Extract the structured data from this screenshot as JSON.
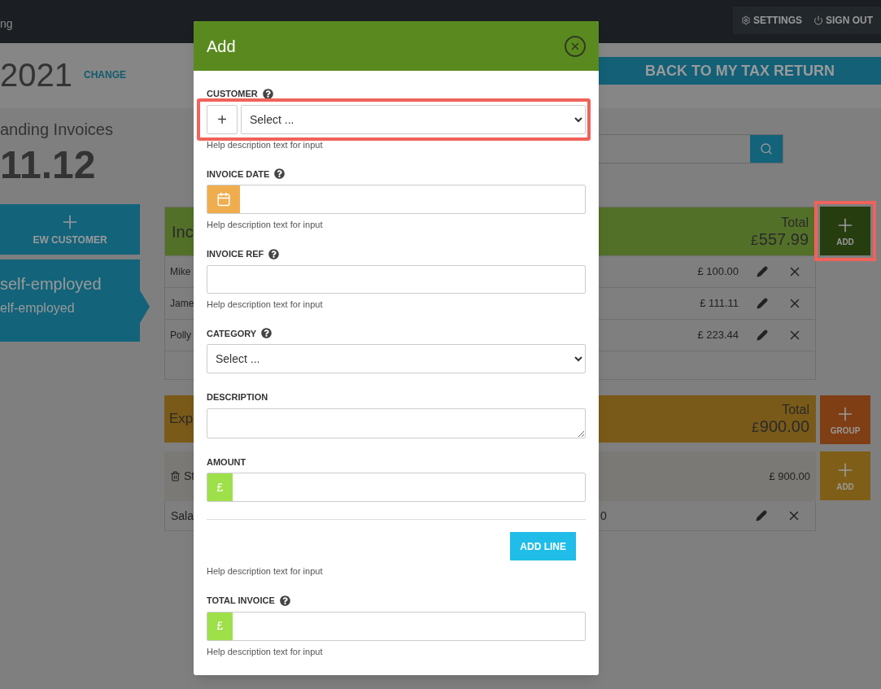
{
  "top_bar": {
    "brand_fragment": "ng",
    "menu": [
      {
        "label": "SETTINGS"
      },
      {
        "label": "SIGN OUT"
      }
    ]
  },
  "period": {
    "year": "2021",
    "change_link": "CHANGE"
  },
  "back_button": "BACK TO MY TAX RETURN",
  "summary": {
    "label": "anding Invoices",
    "amount": "11.12"
  },
  "sidebar": {
    "new_customer": "EW CUSTOMER",
    "items": [
      {
        "title": "self-employed",
        "subtitle": "elf-employed"
      }
    ]
  },
  "income": {
    "title": "Inc",
    "total_label": "Total",
    "currency": "£",
    "total": "557.99",
    "add_label": "ADD",
    "add_highlighted": true,
    "rows": [
      {
        "name": "Mike",
        "amount": "£ 100.00"
      },
      {
        "name": "Jame",
        "amount": "£ 111.11"
      },
      {
        "name": "Polly",
        "amount": "£ 223.44"
      }
    ]
  },
  "expenses": {
    "title": "Exp",
    "total_label": "Total",
    "currency": "£",
    "total": "900.00",
    "group_label": "GROUP",
    "groups": [
      {
        "name": "St",
        "amount": "£ 900.00",
        "add_label": "ADD",
        "rows": [
          {
            "name": "Sala",
            "amount": "0"
          }
        ]
      }
    ]
  },
  "modal": {
    "title": "Add",
    "items": [
      {
        "kind": "select",
        "label": "CUSTOMER",
        "help_icon": true,
        "addon": "+",
        "placeholder": "Select ...",
        "help": "Help description text for input",
        "highlighted": true
      },
      {
        "kind": "date",
        "label": "INVOICE DATE",
        "help_icon": true,
        "help": "Help description text for input",
        "highlighted": false
      },
      {
        "kind": "text",
        "label": "INVOICE REF",
        "help_icon": true,
        "help": "Help description text for input",
        "highlighted": false
      },
      {
        "kind": "select",
        "label": "CATEGORY",
        "help_icon": true,
        "placeholder": "Select ...",
        "highlighted": false
      },
      {
        "kind": "textarea",
        "label": "DESCRIPTION",
        "help_icon": false,
        "highlighted": false
      },
      {
        "kind": "money",
        "label": "AMOUNT",
        "help_icon": false,
        "addon": "£",
        "highlighted": false
      },
      {
        "kind": "button",
        "label": "ADD LINE",
        "help": "Help description text for input",
        "highlighted": false
      },
      {
        "kind": "money",
        "label": "TOTAL INVOICE",
        "help_icon": true,
        "addon": "£",
        "help": "Help description text for input",
        "highlighted": false
      }
    ]
  }
}
